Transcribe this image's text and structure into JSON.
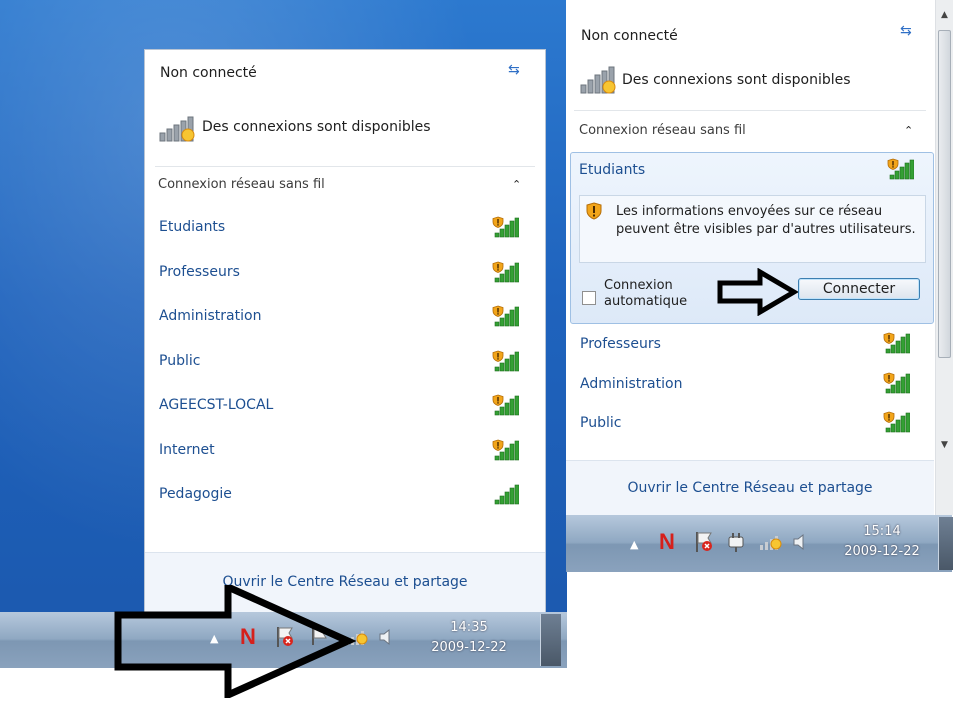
{
  "left": {
    "status_title": "Non connecté",
    "availability_text": "Des connexions sont disponibles",
    "section_label": "Connexion réseau sans fil",
    "networks": [
      {
        "name": "Etudiants",
        "secured": true
      },
      {
        "name": "Professeurs",
        "secured": true
      },
      {
        "name": "Administration",
        "secured": true
      },
      {
        "name": "Public",
        "secured": true
      },
      {
        "name": "AGEECST-LOCAL",
        "secured": true
      },
      {
        "name": "Internet",
        "secured": true
      },
      {
        "name": "Pedagogie",
        "secured": false
      }
    ],
    "footer_link": "Ouvrir le Centre Réseau et partage",
    "clock": {
      "time": "14:35",
      "date": "2009-12-22"
    }
  },
  "right": {
    "status_title": "Non connecté",
    "availability_text": "Des connexions sont disponibles",
    "section_label": "Connexion réseau sans fil",
    "selected_network": "Etudiants",
    "warning_text": "Les informations envoyées sur ce réseau peuvent être visibles par d'autres utilisateurs.",
    "auto_connect_label": "Connexion automatique",
    "auto_connect_checked": false,
    "connect_button": "Connecter",
    "networks": [
      {
        "name": "Professeurs",
        "secured": true
      },
      {
        "name": "Administration",
        "secured": true
      },
      {
        "name": "Public",
        "secured": true
      }
    ],
    "footer_link": "Ouvrir le Centre Réseau et partage",
    "clock": {
      "time": "15:14",
      "date": "2009-12-22"
    }
  },
  "icons": {
    "refresh": "refresh-icon",
    "collapse": "chevron-up-icon",
    "signal": "wifi-signal-icon",
    "shield": "security-shield-icon",
    "tray": [
      "show-hidden-icons-chevron",
      "norton-icon",
      "action-center-flag-icon",
      "power-plug-icon",
      "network-icon",
      "volume-icon"
    ]
  },
  "colors": {
    "link_blue": "#1d4f91",
    "desktop_blue": "#1f63bd",
    "highlight": "#dde9f8",
    "shield_orange": "#f2a51a",
    "signal_green": "#2e9a2e"
  }
}
